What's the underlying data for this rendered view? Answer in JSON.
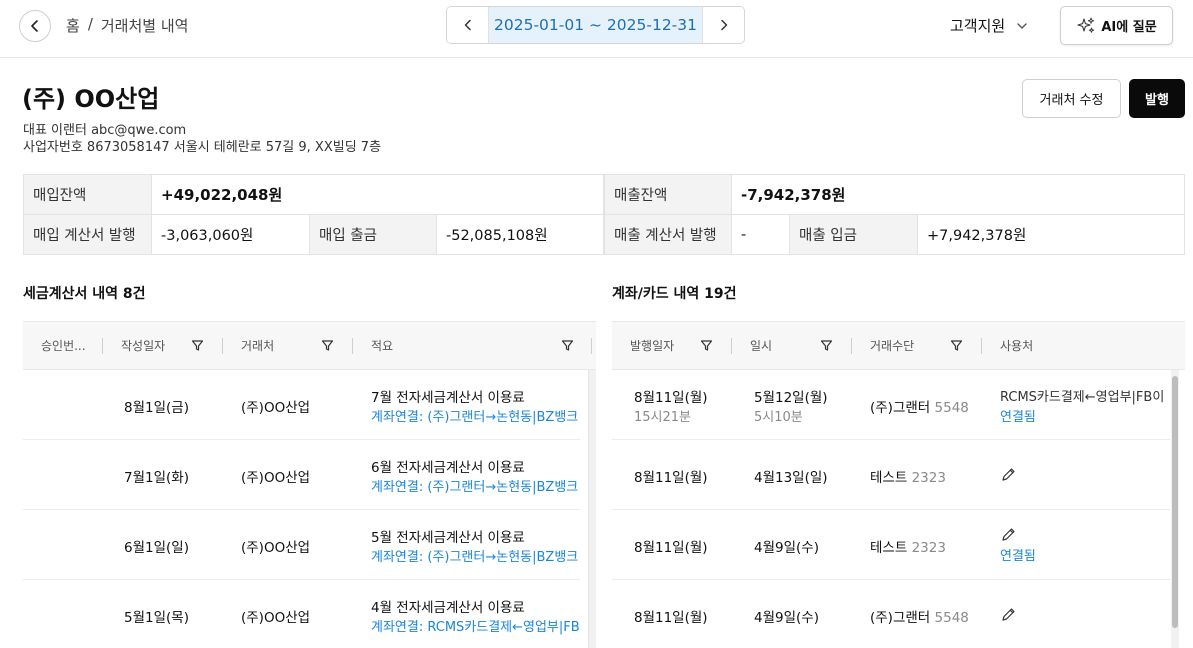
{
  "header": {
    "breadcrumb": [
      "홈",
      "/",
      "거래처별 내역"
    ],
    "date_range": "2025-01-01 ~ 2025-12-31",
    "support_label": "고객지원",
    "ai_label": "AI에 질문"
  },
  "company": {
    "name": "(주) OO산업",
    "rep_line": "대표 이랜터  abc@qwe.com",
    "biz_line": "사업자번호 8673058147 서울시 테헤란로 57길 9, XX빌딩 7층",
    "edit_label": "거래처 수정",
    "issue_label": "발행"
  },
  "summary": {
    "purchase_balance_label": "매입잔액",
    "purchase_balance": "+49,022,048원",
    "sales_balance_label": "매출잔액",
    "sales_balance": "-7,942,378원",
    "purchase_invoice_label": "매입 계산서 발행",
    "purchase_invoice": "-3,063,060원",
    "purchase_out_label": "매입 출금",
    "purchase_out": "-52,085,108원",
    "sales_invoice_label": "매출 계산서 발행",
    "sales_invoice": "-",
    "sales_in_label": "매출 입금",
    "sales_in": "+7,942,378원"
  },
  "tax_table": {
    "title": "세금계산서 내역 8건",
    "headers": [
      "승인번...",
      "작성일자",
      "거래처",
      "적요"
    ],
    "rows": [
      {
        "date": "8월1일(금)",
        "vendor": "(주)OO산업",
        "memo": "7월 전자세금계산서 이용료",
        "link": "계좌연결: (주)그랜터→논현동|BZ뱅크"
      },
      {
        "date": "7월1일(화)",
        "vendor": "(주)OO산업",
        "memo": "6월 전자세금계산서 이용료",
        "link": "계좌연결: (주)그랜터→논현동|BZ뱅크"
      },
      {
        "date": "6월1일(일)",
        "vendor": "(주)OO산업",
        "memo": "5월 전자세금계산서 이용료",
        "link": "계좌연결: (주)그랜터→논현동|BZ뱅크"
      },
      {
        "date": "5월1일(목)",
        "vendor": "(주)OO산업",
        "memo": "4월 전자세금계산서 이용료",
        "link": "계좌연결: RCMS카드결제←영업부|FB"
      }
    ]
  },
  "card_table": {
    "title": "계좌/카드 내역 19건",
    "headers": [
      "발행일자",
      "일시",
      "거래수단",
      "사용처"
    ],
    "rows": [
      {
        "issue_date": "8월11일(월)",
        "issue_time": "15시21분",
        "date": "5월12일(월)",
        "time": "5시10분",
        "method": "(주)그랜터",
        "method_no": "5548",
        "usage": "RCMS카드결제←영업부|FB이",
        "link": "연결됨",
        "pencil": false
      },
      {
        "issue_date": "8월11일(월)",
        "issue_time": "",
        "date": "4월13일(일)",
        "time": "",
        "method": "테스트",
        "method_no": "2323",
        "usage": "",
        "link": "",
        "pencil": true
      },
      {
        "issue_date": "8월11일(월)",
        "issue_time": "",
        "date": "4월9일(수)",
        "time": "",
        "method": "테스트",
        "method_no": "2323",
        "usage": "",
        "link": "연결됨",
        "pencil": true
      },
      {
        "issue_date": "8월11일(월)",
        "issue_time": "",
        "date": "4월9일(수)",
        "time": "",
        "method": "(주)그랜터",
        "method_no": "5548",
        "usage": "",
        "link": "",
        "pencil": true
      }
    ]
  },
  "colors": {
    "accent": "#1a86d8",
    "date_bg": "#e6f2fb",
    "primary_button": "#0a0a0a"
  },
  "icons": [
    "chevron-left-icon",
    "chevron-right-icon",
    "chevron-down-icon",
    "sparkle-icon",
    "filter-icon",
    "pencil-icon"
  ]
}
